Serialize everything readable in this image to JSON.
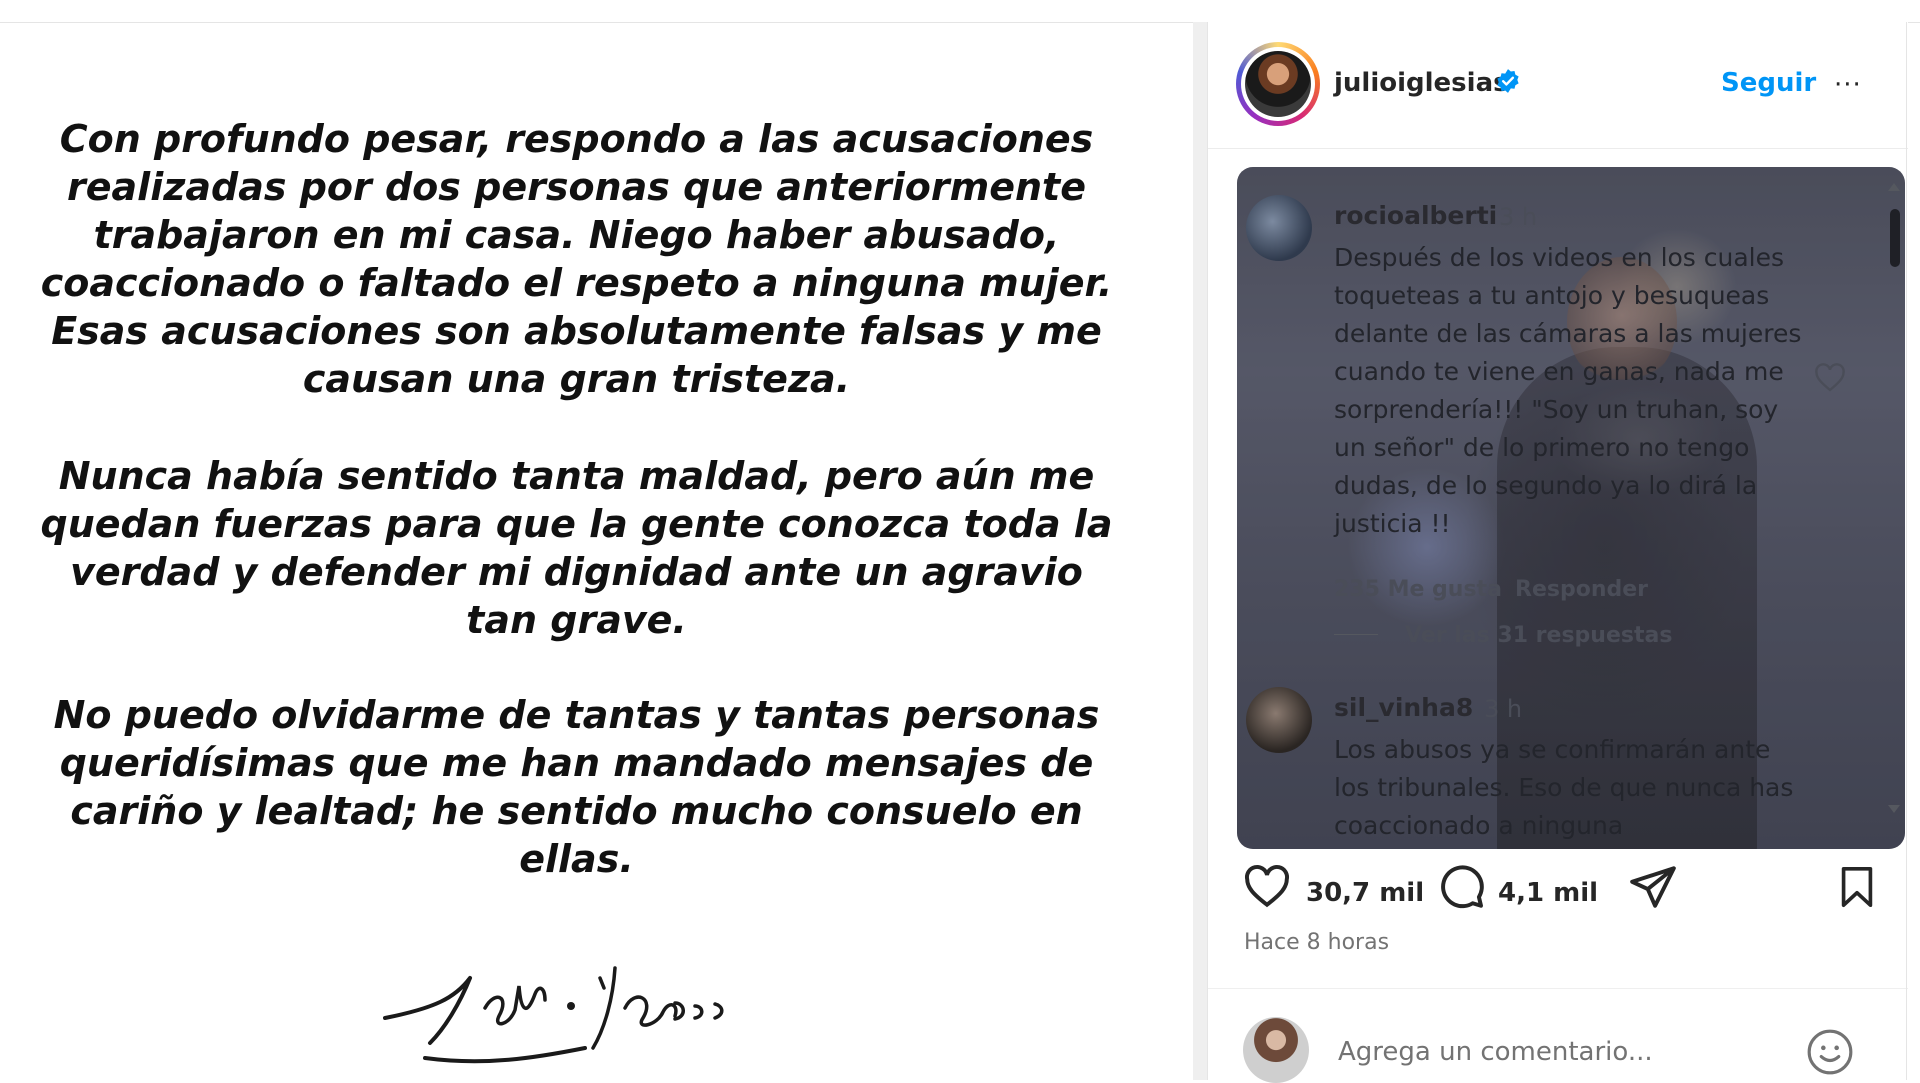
{
  "statement": {
    "paragraph1": "Con profundo pesar, respondo a las acusaciones realizadas por dos personas que anteriormente trabajaron en mi casa. Niego haber abusado, coaccionado o faltado el respeto a ninguna mujer. Esas acusaciones son absolutamente falsas y me causan una gran tristeza.",
    "paragraph2": "Nunca había sentido tanta maldad, pero aún me quedan fuerzas para que la gente conozca toda la verdad y defender mi dignidad ante un agravio tan grave.",
    "paragraph3": "No puedo olvidarme de tantas y tantas personas queridísimas que me han mandado mensajes de cariño y lealtad; he sentido mucho consuelo en ellas."
  },
  "post": {
    "username": "julioiglesias",
    "follow_label": "Seguir",
    "more_label": "···"
  },
  "comments": [
    {
      "user": "rocioalberti",
      "time": "3 h",
      "text": "Después de los videos en los cuales toqueteas a tu antojo y besuqueas delante de las cámaras a las mujeres cuando te viene en ganas, nada me sorprendería!!! \"Soy un truhan, soy un señor\" de lo primero no tengo dudas, de lo segundo ya lo dirá la justicia !!",
      "likes": "235 Me gusta",
      "reply_label": "Responder",
      "view_replies": "Ver las 31 respuestas"
    },
    {
      "user": "sil_vinha8",
      "time": "3 h",
      "text": "Los abusos ya se confirmarán ante los tribunales. Eso de que nunca has coaccionado a ninguna"
    }
  ],
  "actions": {
    "likes": "30,7 mil",
    "comments": "4,1 mil"
  },
  "timestamp": "Hace 8 horas",
  "comment_input": {
    "placeholder": "Agrega un comentario..."
  },
  "colors": {
    "follow": "#0095f6",
    "verified": "#0095f6"
  }
}
